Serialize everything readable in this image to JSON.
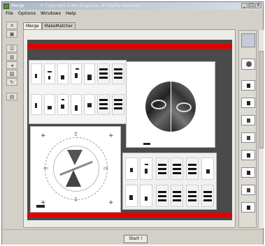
{
  "window": {
    "title": "Merge",
    "copyright": "© Copyright Eskio Graphics. All Rights reserved.",
    "controls": {
      "minimize": "_",
      "maximize": "□",
      "close": "×"
    }
  },
  "menu": {
    "items": [
      "File",
      "Options",
      "Windows",
      "Help"
    ]
  },
  "tabs": [
    {
      "label": "Merge",
      "active": true
    },
    {
      "label": "MakeMatcher",
      "active": false
    }
  ],
  "toolbox": {
    "tools": [
      {
        "name": "select-tool-icon",
        "glyph": "✕"
      },
      {
        "name": "fit-tool-icon",
        "glyph": "▣"
      },
      {
        "name": "print-tool-icon",
        "glyph": "⎙"
      },
      {
        "name": "arrange-tool-icon",
        "glyph": "▥"
      },
      {
        "name": "left-tool-icon",
        "glyph": "◂"
      },
      {
        "name": "image-tool-icon",
        "glyph": "▨"
      },
      {
        "name": "rotate-tool-icon",
        "glyph": "↻"
      },
      {
        "name": "extra-tool-icon",
        "glyph": "▤"
      }
    ]
  },
  "bottom": {
    "start_label": "Start !"
  },
  "colors": {
    "accent_red": "#e00000",
    "background_dark": "#4a4a4a",
    "window_gray": "#d4d0c8"
  }
}
